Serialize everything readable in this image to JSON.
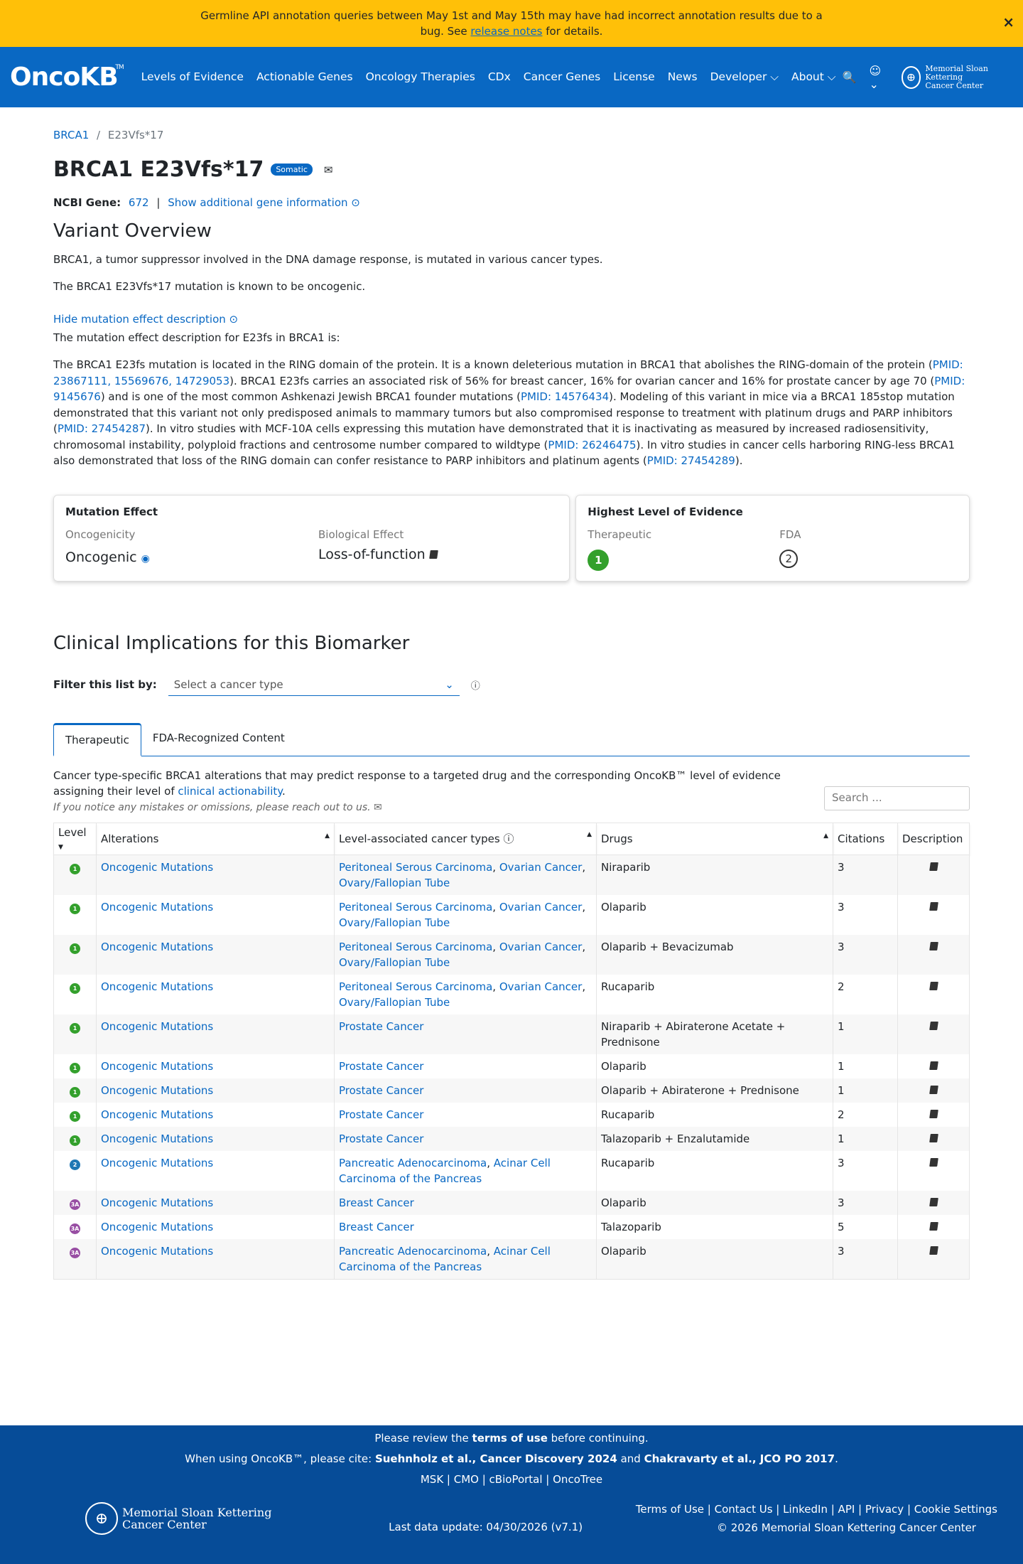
{
  "banner": {
    "text_a": "Germline API annotation queries between May 1st and May 15th may have had incorrect annotation results due to a bug. See ",
    "link": "release notes",
    "text_b": " for details.",
    "close": "×"
  },
  "nav": {
    "logo": "OncoKB",
    "tm": "TM",
    "items": [
      "Levels of Evidence",
      "Actionable Genes",
      "Oncology Therapies",
      "CDx",
      "Cancer Genes",
      "License",
      "News",
      "Developer ⌵",
      "About ⌵"
    ],
    "msk": [
      "Memorial Sloan Kettering",
      "Cancer Center"
    ]
  },
  "breadcrumb": {
    "gene": "BRCA1",
    "sep": "/",
    "variant": "E23Vfs*17"
  },
  "title": "BRCA1 E23Vfs*17",
  "somatic": "Somatic",
  "ncbi": {
    "label": "NCBI Gene:",
    "id": "672",
    "sep": "|",
    "more": "Show additional gene information ⊙"
  },
  "overview": {
    "heading": "Variant Overview",
    "p1": "BRCA1, a tumor suppressor involved in the DNA damage response, is mutated in various cancer types.",
    "p2": "The BRCA1 E23Vfs*17 mutation is known to be oncogenic.",
    "hide": "Hide mutation effect description ⊙",
    "p3": "The mutation effect description for E23fs in BRCA1 is:"
  },
  "description": [
    {
      "t": "The BRCA1 E23fs mutation is located in the RING domain of the protein. It is a known deleterious mutation in BRCA1 that abolishes the RING-domain of the protein ("
    },
    {
      "l": "PMID: 23867111, 15569676, 14729053"
    },
    {
      "t": "). BRCA1 E23fs carries an associated risk of 56% for breast cancer, 16% for ovarian cancer and 16% for prostate cancer by age 70 ("
    },
    {
      "l": "PMID: 9145676"
    },
    {
      "t": ") and is one of the most common Ashkenazi Jewish BRCA1 founder mutations ("
    },
    {
      "l": "PMID: 14576434"
    },
    {
      "t": "). Modeling of this variant in mice via a BRCA1 185stop mutation demonstrated that this variant not only predisposed animals to mammary tumors but also compromised response to treatment with platinum drugs and PARP inhibitors ("
    },
    {
      "l": "PMID: 27454287"
    },
    {
      "t": "). In vitro studies with MCF-10A cells expressing this mutation have demonstrated that it is inactivating as measured by increased radiosensitivity, chromosomal instability, polyploid fractions and centrosome number compared to wildtype ("
    },
    {
      "l": "PMID: 26246475"
    },
    {
      "t": "). In vitro studies in cancer cells harboring RING-less BRCA1 also demonstrated that loss of the RING domain can confer resistance to PARP inhibitors and platinum agents ("
    },
    {
      "l": "PMID: 27454289"
    },
    {
      "t": ")."
    }
  ],
  "mutation_effect": {
    "heading": "Mutation Effect",
    "onc_label": "Oncogenicity",
    "onc_value": "Oncogenic",
    "bio_label": "Biological Effect",
    "bio_value": "Loss-of-function"
  },
  "evidence": {
    "heading": "Highest Level of Evidence",
    "ther_label": "Therapeutic",
    "ther_value": "1",
    "fda_label": "FDA",
    "fda_value": "2"
  },
  "clinical": {
    "heading": "Clinical Implications for this Biomarker",
    "filter_label": "Filter this list by:",
    "select_placeholder": "Select a cancer type"
  },
  "tabs": [
    "Therapeutic",
    "FDA-Recognized Content"
  ],
  "info": {
    "text": "Cancer type-specific BRCA1 alterations that may predict response to a targeted drug and the corresponding OncoKB™ level of evidence assigning their level of ",
    "link": "clinical actionability",
    "end": ".",
    "note": "If you notice any mistakes or omissions, please reach out to us. ✉",
    "search": "Search ..."
  },
  "columns": [
    "Level",
    "Alterations",
    "Level-associated cancer types ⓘ",
    "Drugs",
    "Citations",
    "Description"
  ],
  "rows": [
    {
      "level": "1",
      "alt": "Oncogenic Mutations",
      "cancers": [
        "Peritoneal Serous Carcinoma",
        "Ovarian Cancer",
        "Ovary/Fallopian Tube"
      ],
      "drugs": "Niraparib",
      "cit": "3"
    },
    {
      "level": "1",
      "alt": "Oncogenic Mutations",
      "cancers": [
        "Peritoneal Serous Carcinoma",
        "Ovarian Cancer",
        "Ovary/Fallopian Tube"
      ],
      "drugs": "Olaparib",
      "cit": "3"
    },
    {
      "level": "1",
      "alt": "Oncogenic Mutations",
      "cancers": [
        "Peritoneal Serous Carcinoma",
        "Ovarian Cancer",
        "Ovary/Fallopian Tube"
      ],
      "drugs": "Olaparib + Bevacizumab",
      "cit": "3"
    },
    {
      "level": "1",
      "alt": "Oncogenic Mutations",
      "cancers": [
        "Peritoneal Serous Carcinoma",
        "Ovarian Cancer",
        "Ovary/Fallopian Tube"
      ],
      "drugs": "Rucaparib",
      "cit": "2"
    },
    {
      "level": "1",
      "alt": "Oncogenic Mutations",
      "cancers": [
        "Prostate Cancer"
      ],
      "drugs": "Niraparib + Abiraterone Acetate + Prednisone",
      "cit": "1"
    },
    {
      "level": "1",
      "alt": "Oncogenic Mutations",
      "cancers": [
        "Prostate Cancer"
      ],
      "drugs": "Olaparib",
      "cit": "1"
    },
    {
      "level": "1",
      "alt": "Oncogenic Mutations",
      "cancers": [
        "Prostate Cancer"
      ],
      "drugs": "Olaparib + Abiraterone + Prednisone",
      "cit": "1"
    },
    {
      "level": "1",
      "alt": "Oncogenic Mutations",
      "cancers": [
        "Prostate Cancer"
      ],
      "drugs": "Rucaparib",
      "cit": "2"
    },
    {
      "level": "1",
      "alt": "Oncogenic Mutations",
      "cancers": [
        "Prostate Cancer"
      ],
      "drugs": "Talazoparib + Enzalutamide",
      "cit": "1"
    },
    {
      "level": "2",
      "alt": "Oncogenic Mutations",
      "cancers": [
        "Pancreatic Adenocarcinoma",
        "Acinar Cell Carcinoma of the Pancreas"
      ],
      "drugs": "Rucaparib",
      "cit": "3"
    },
    {
      "level": "3A",
      "alt": "Oncogenic Mutations",
      "cancers": [
        "Breast Cancer"
      ],
      "drugs": "Olaparib",
      "cit": "3"
    },
    {
      "level": "3A",
      "alt": "Oncogenic Mutations",
      "cancers": [
        "Breast Cancer"
      ],
      "drugs": "Talazoparib",
      "cit": "5"
    },
    {
      "level": "3A",
      "alt": "Oncogenic Mutations",
      "cancers": [
        "Pancreatic Adenocarcinoma",
        "Acinar Cell Carcinoma of the Pancreas"
      ],
      "drugs": "Olaparib",
      "cit": "3"
    }
  ],
  "footer": {
    "review_a": "Please review the ",
    "review_b": "terms of use",
    "review_c": " before continuing.",
    "cite_a": "When using OncoKB™, please cite: ",
    "cite_b": "Suehnholz et al., Cancer Discovery 2024",
    "cite_c": " and ",
    "cite_d": "Chakravarty et al., JCO PO 2017",
    "cite_e": ".",
    "partners": "MSK | CMO | cBioPortal | OncoTree",
    "msk": [
      "Memorial Sloan Kettering",
      "Cancer Center"
    ],
    "update": "Last data update: 04/30/2026 (v7.1)",
    "links": "Terms of Use | Contact Us | LinkedIn | API | Privacy | Cookie Settings",
    "copyright": "© 2026 Memorial Sloan Kettering Cancer Center"
  }
}
